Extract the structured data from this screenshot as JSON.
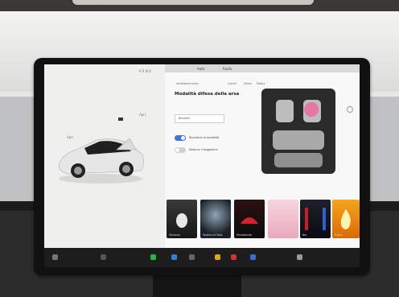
{
  "screen": {
    "status": {
      "left_status": "P R N D",
      "tabs": [
        "Auto",
        "Radio"
      ]
    },
    "left_pane": {
      "top_small_text": "",
      "label_a": "Apri",
      "label_b": "Apri"
    },
    "right_pane": {
      "nav_tabs": [
        "Intrattenimento",
        "Giochi",
        "Video",
        "Media"
      ],
      "mode_title": "Modalità difesa della arsa",
      "mode_desc": "",
      "dropdown_value": "Bambini",
      "toggle_1_label": "Ripristina la modalità",
      "toggle_2_label": "Sblocca il seggiolino"
    },
    "tiles": [
      {
        "label": "Ginnasio"
      },
      {
        "label": "Tastiera di Babi"
      },
      {
        "label": "Montalenda"
      },
      {
        "label": ""
      },
      {
        "label": "Bar"
      },
      {
        "label": "Fuoco"
      }
    ]
  },
  "colors": {
    "accent": "#3b73e0",
    "screen_bg": "#f4f4f3",
    "bezel": "#111111",
    "dock": "#1d1d1d"
  }
}
